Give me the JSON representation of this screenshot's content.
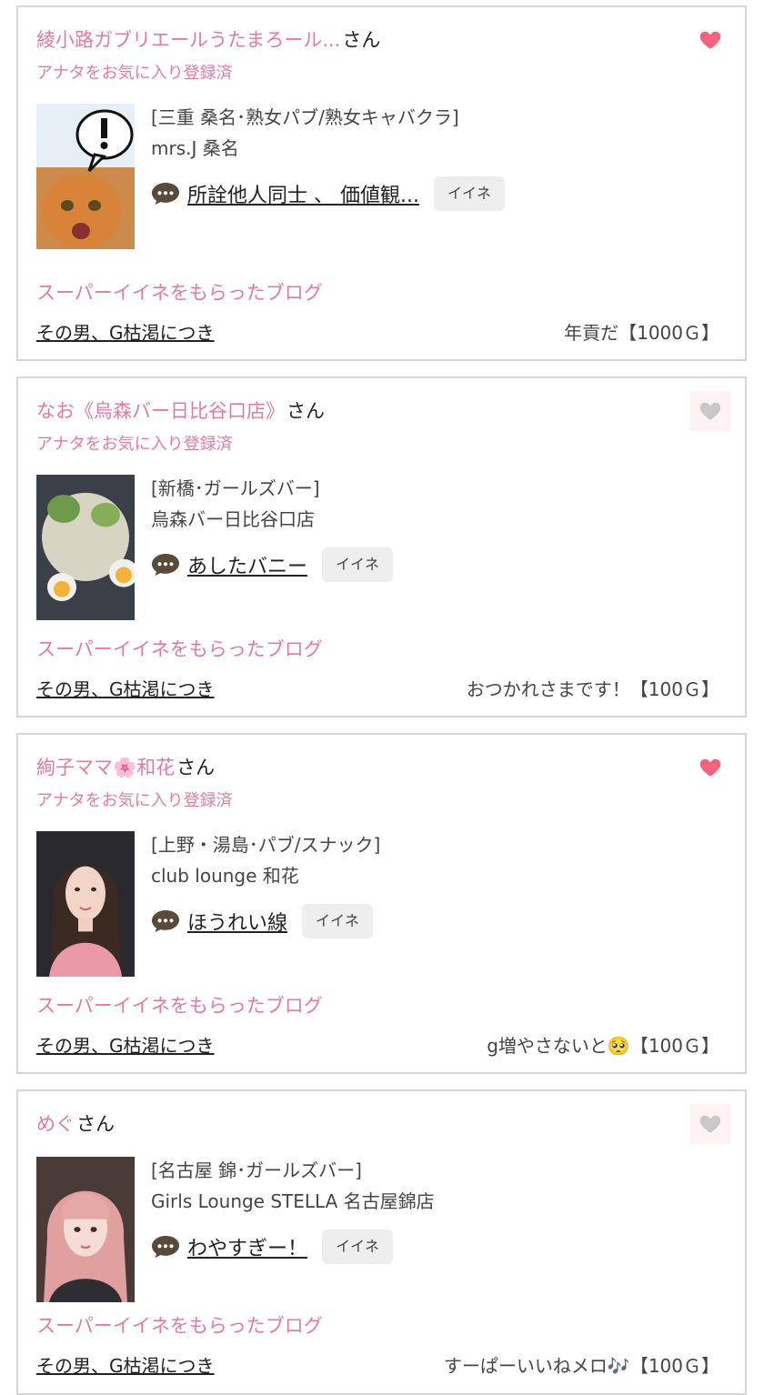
{
  "accent_color": "#e27aa4",
  "items": [
    {
      "name": "綾小路ガブリエールうたまろール...",
      "suffix": "さん",
      "fav_status": "アナタをお気に入り登録済",
      "heart": "filled",
      "category": "[三重 桑名･熟女パブ/熟女キャバクラ]",
      "shop": "mrs.J 桑名",
      "comment": "所詮他人同士 、 価値観...",
      "iine": "イイネ",
      "super_label": "スーパーイイネをもらったブログ",
      "blog_title": "その男、G枯渇につき",
      "reward": "年貢だ【1000Ｇ】"
    },
    {
      "name": "なお《烏森バー日比谷口店》",
      "suffix": "さん",
      "fav_status": "アナタをお気に入り登録済",
      "heart": "empty",
      "category": "[新橋･ガールズバー]",
      "shop": "烏森バー日比谷口店",
      "comment": "あしたバニー",
      "iine": "イイネ",
      "super_label": "スーパーイイネをもらったブログ",
      "blog_title": "その男、G枯渇につき",
      "reward": "おつかれさまです！【100Ｇ】"
    },
    {
      "name": "絢子ママ🌸和花",
      "suffix": "さん",
      "fav_status": "アナタをお気に入り登録済",
      "heart": "filled",
      "category": "[上野・湯島･パブ/スナック]",
      "shop": "club lounge 和花",
      "comment": "ほうれい線",
      "iine": "イイネ",
      "super_label": "スーパーイイネをもらったブログ",
      "blog_title": "その男、G枯渇につき",
      "reward": "g増やさないと🥺【100Ｇ】"
    },
    {
      "name": "めぐ",
      "suffix": "さん",
      "fav_status": "",
      "heart": "empty",
      "category": "[名古屋 錦･ガールズバー]",
      "shop": "Girls Lounge STELLA 名古屋錦店",
      "comment": "わやすぎー！",
      "iine": "イイネ",
      "super_label": "スーパーイイネをもらったブログ",
      "blog_title": "その男、G枯渇につき",
      "reward": "すーぱーいいねメロ🎶【100Ｇ】"
    }
  ]
}
